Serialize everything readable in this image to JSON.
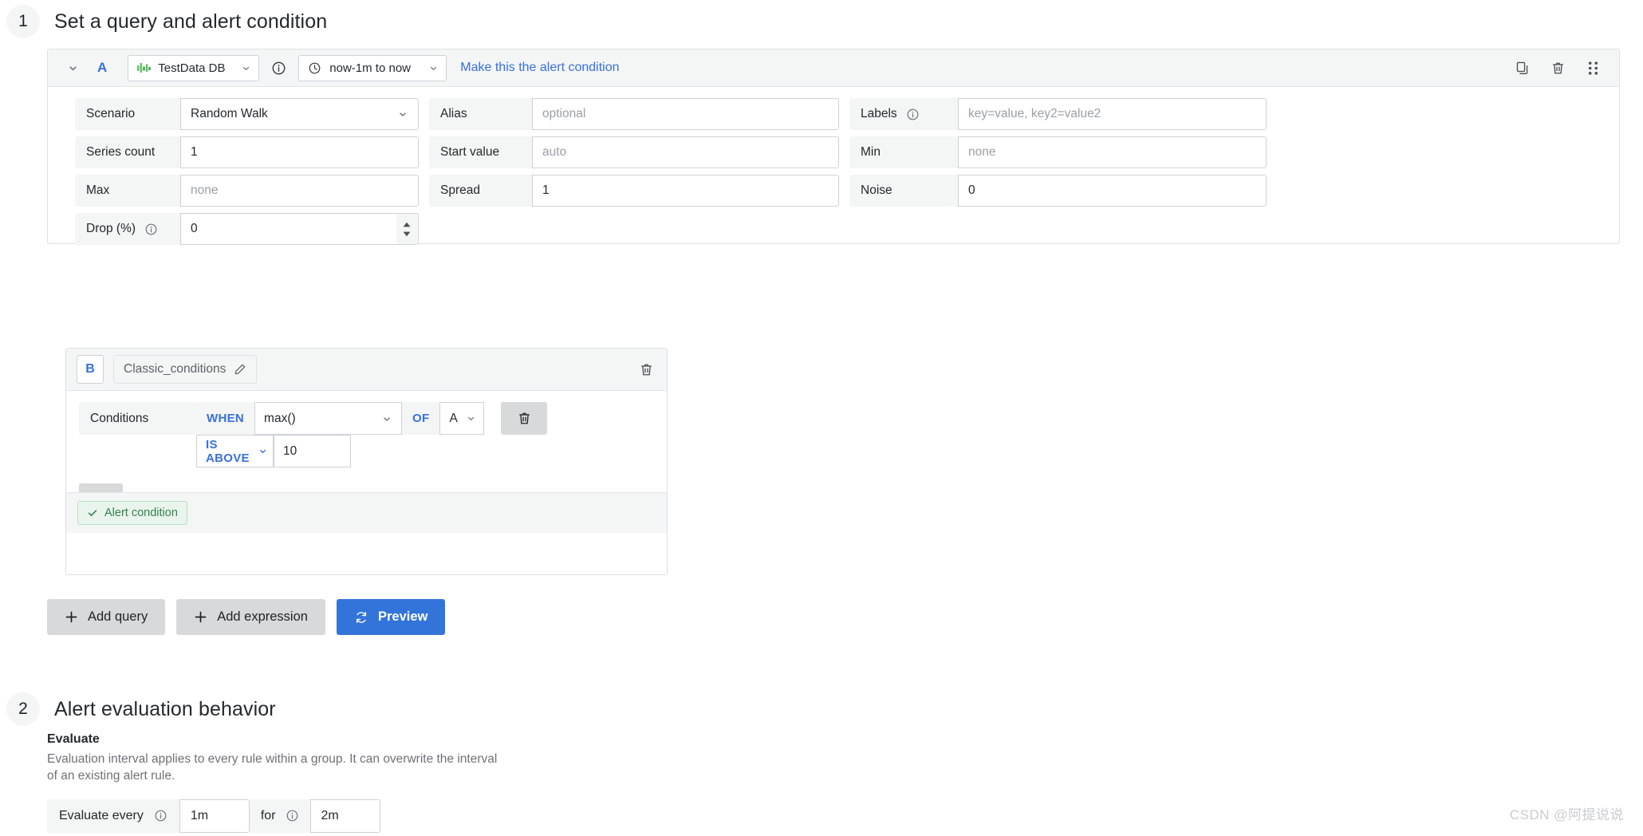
{
  "steps": [
    {
      "number": "1",
      "title": "Set a query and alert condition"
    },
    {
      "number": "2",
      "title": "Alert evaluation behavior"
    }
  ],
  "query": {
    "ref_id": "A",
    "datasource": "TestData DB",
    "datasource_icon": "testdata-bars-icon",
    "time_range": "now-1m to now",
    "alert_condition_link": "Make this the alert condition",
    "actions": {
      "copy": "copy-query",
      "delete": "delete-query",
      "drag": "drag-query"
    },
    "fields": {
      "scenario": {
        "label": "Scenario",
        "value": "Random Walk"
      },
      "alias": {
        "label": "Alias",
        "value": "",
        "placeholder": "optional"
      },
      "labels": {
        "label": "Labels",
        "value": "",
        "placeholder": "key=value, key2=value2"
      },
      "series_count": {
        "label": "Series count",
        "value": "1"
      },
      "start_value": {
        "label": "Start value",
        "value": "",
        "placeholder": "auto"
      },
      "min": {
        "label": "Min",
        "value": "",
        "placeholder": "none"
      },
      "max": {
        "label": "Max",
        "value": "",
        "placeholder": "none"
      },
      "spread": {
        "label": "Spread",
        "value": "1"
      },
      "noise": {
        "label": "Noise",
        "value": "0"
      },
      "drop": {
        "label": "Drop (%)",
        "value": "0"
      }
    }
  },
  "expression": {
    "ref_id": "B",
    "name": "Classic_conditions",
    "conditions_label": "Conditions",
    "when_label": "WHEN",
    "reducer": "max()",
    "of_label": "OF",
    "of_query": "A",
    "operator": "IS ABOVE",
    "threshold": "10",
    "alert_condition_badge": "Alert condition",
    "add_condition": "add-condition",
    "delete_condition": "delete-condition",
    "delete_expression": "delete-expression"
  },
  "toolbar": {
    "add_query": "Add query",
    "add_expression": "Add expression",
    "preview": "Preview"
  },
  "evaluation": {
    "heading": "Evaluate",
    "description": "Evaluation interval applies to every rule within a group. It can overwrite the interval of an existing alert rule.",
    "every_label": "Evaluate every",
    "every_value": "1m",
    "for_label": "for",
    "for_value": "2m"
  },
  "watermark": "CSDN @阿提说说",
  "colors": {
    "accent_blue": "#3871dc",
    "primary_button": "#3274d9",
    "grey_button": "#d8d9da",
    "panel_grey": "#f4f5f5",
    "border": "#cdd2d8",
    "success_green": "#35804f",
    "datasource_icon_green": "#68c46a"
  }
}
